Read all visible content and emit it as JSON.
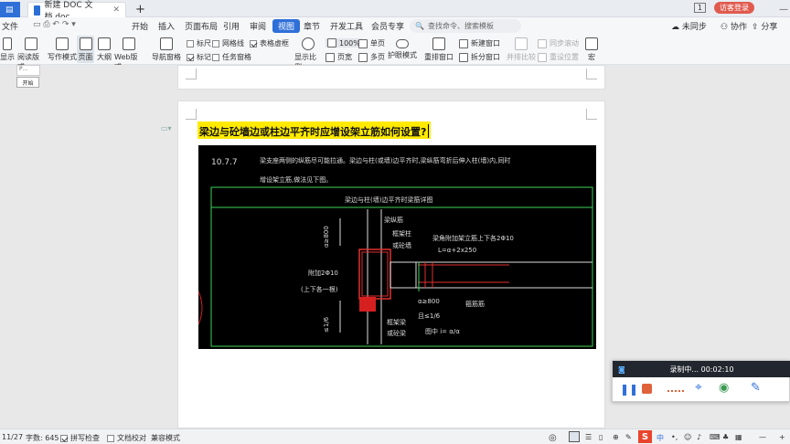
{
  "tabs": {
    "file_tab": "文件",
    "doc_tab": "新建 DOC 文档.doc",
    "new_tab": "+"
  },
  "top_right": {
    "badge": "1",
    "login": "访客登录"
  },
  "menu": {
    "items": [
      "开始",
      "插入",
      "页面布局",
      "引用",
      "审阅",
      "视图",
      "章节",
      "开发工具",
      "会员专享"
    ],
    "active": "视图",
    "search_placeholder": "查找命令、搜索模板"
  },
  "menu_right": {
    "sync": "未同步",
    "collab": "协作",
    "share": "分享"
  },
  "ribbon": {
    "show": "显示",
    "read_mode": "阅读版式",
    "write_mode": "写作模式",
    "page": "页面",
    "outline": "大纲",
    "web": "Web版式",
    "nav": "导航窗格",
    "ruler": "标尺",
    "gridlines": "网格线",
    "table_border": "表格虚框",
    "mark": "标记",
    "task_pane": "任务窗格",
    "zoom": "显示比例",
    "zoom_value": "100%",
    "page_width": "页宽",
    "single_page": "单页",
    "multi_page": "多页",
    "eye": "护眼模式",
    "rearrange": "重排窗口",
    "new_window": "新建窗口",
    "split": "拆分窗口",
    "side_by_side": "并排比较",
    "sync_scroll": "同步滚动",
    "reset_pos": "重设位置",
    "macro": "宏"
  },
  "tooltip": "开始",
  "document": {
    "heading": "梁边与砼墙边或柱边平齐时应增设架立筋如何设置?",
    "cad": {
      "section": "10.7.7",
      "line1": "梁支座两侧的纵筋尽可能拉通。梁边与柱(或墙)边平齐时,梁纵筋弯折后伸入柱(墙)内,同时",
      "line2": "增设架立筋,做法见下图。",
      "frame_title": "梁边与柱(墙)边平齐时梁筋详图",
      "labels": {
        "beam_long": "梁纵筋",
        "frame_col": "框架柱",
        "shear_wall": "或砼墙",
        "added_bar": "梁角附加架立筋上下各2Φ10",
        "formula": "L=α+2x250",
        "attach": "附加2Φ10",
        "attach2": "(上下各一根)",
        "a800": "α≥800",
        "ratio": "且≤1/6",
        "fig": "图中 i= α/α",
        "stirrup": "箍筋筋",
        "frame_beam": "框架梁",
        "or_wall_beam": "或砼梁",
        "dim": "≤1/6"
      }
    }
  },
  "recorder": {
    "title": "录制中... 00:02:10"
  },
  "status": {
    "page": "11/27",
    "words": "字数: 645",
    "spell": "拼写检查",
    "proof": "文档校对",
    "compat": "兼容模式",
    "ime": "中"
  }
}
